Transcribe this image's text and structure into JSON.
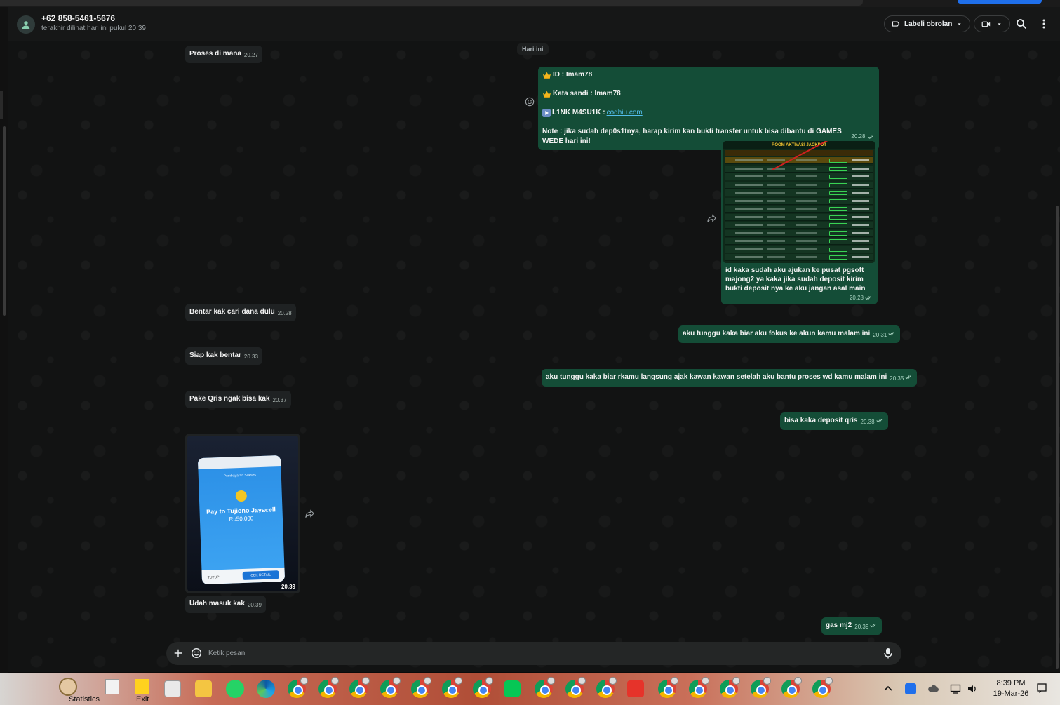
{
  "header": {
    "contact_name": "+62 858-5461-5676",
    "last_seen": "terakhir dilihat hari ini pukul 20.39",
    "label_button": "Labeli obrolan"
  },
  "day_divider": "Hari ini",
  "messages": {
    "m1": {
      "text": "Proses di mana",
      "time": "20.27"
    },
    "m2": {
      "id_line": "ID :  Imam78",
      "pass_line": "Kata sandi : Imam78",
      "link_label": "L1NK M4SU1K : ",
      "link_url": "codhiu.com",
      "note": "Note : jika sudah dep0s1tnya, harap kirim kan bukti transfer untuk bisa dibantu di GAMES WEDE hari ini!",
      "time": "20.28"
    },
    "m3": {
      "image_title": "ROOM AKTIVASI JACKPOT",
      "caption": "id kaka sudah aku ajukan ke pusat pgsoft majong2 ya kaka jika sudah deposit kirim bukti deposit nya ke aku jangan asal main",
      "time": "20.28"
    },
    "m4": {
      "text": "Bentar kak cari dana dulu",
      "time": "20.28"
    },
    "m5": {
      "text": "aku tunggu kaka biar aku fokus ke akun kamu malam ini",
      "time": "20.31"
    },
    "m6": {
      "text": "Siap kak bentar",
      "time": "20.33"
    },
    "m7": {
      "text": "aku tunggu kaka biar rkamu langsung ajak kawan kawan setelah aku bantu proses wd kamu malam ini",
      "time": "20.35"
    },
    "m8": {
      "text": "Pake Qris ngak bisa kak",
      "time": "20.37"
    },
    "m9": {
      "text": "bisa kaka deposit qris",
      "time": "20.38"
    },
    "m10": {
      "photo_pay_text": "Pay to Tujiono Jayacell",
      "photo_amount": "Rp50.000",
      "photo_label": "Pembayaran Sukses",
      "photo_button": "CEK DETAIL",
      "photo_button2": "TUTUP",
      "time": "20.39"
    },
    "m11": {
      "text": "Udah masuk kak",
      "time": "20.39"
    },
    "m12": {
      "text": "gas mj2",
      "time": "20.39"
    }
  },
  "composer": {
    "placeholder": "Ketik pesan"
  },
  "taskbar": {
    "statistics_label": "Statistics",
    "exit_label": "Exit",
    "time": "8:39 PM",
    "date": "19-Mar-26"
  },
  "colors": {
    "incoming_bubble": "#1f2223",
    "outgoing_bubble": "#144d37",
    "link": "#53bdeb",
    "header_bg": "#161717"
  }
}
